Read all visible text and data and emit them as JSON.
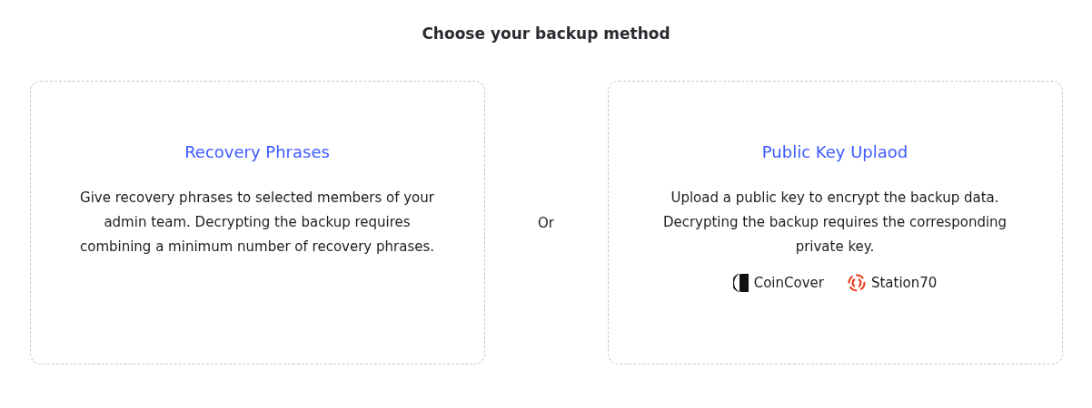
{
  "heading": "Choose your backup method",
  "methods": [
    {
      "title": "Recovery Phrases",
      "description": "Give recovery phrases to selected members of your admin team. Decrypting the backup requires combining a minimum number of recovery phrases."
    },
    {
      "title": "Public Key Uplaod",
      "description": "Upload a public key to encrypt the backup data. Decrypting the backup requires the corresponding private key.",
      "partners": [
        {
          "kind": "coincover",
          "name": "CoinCover"
        },
        {
          "kind": "station",
          "name": "Station70"
        }
      ]
    }
  ],
  "separator": "Or"
}
